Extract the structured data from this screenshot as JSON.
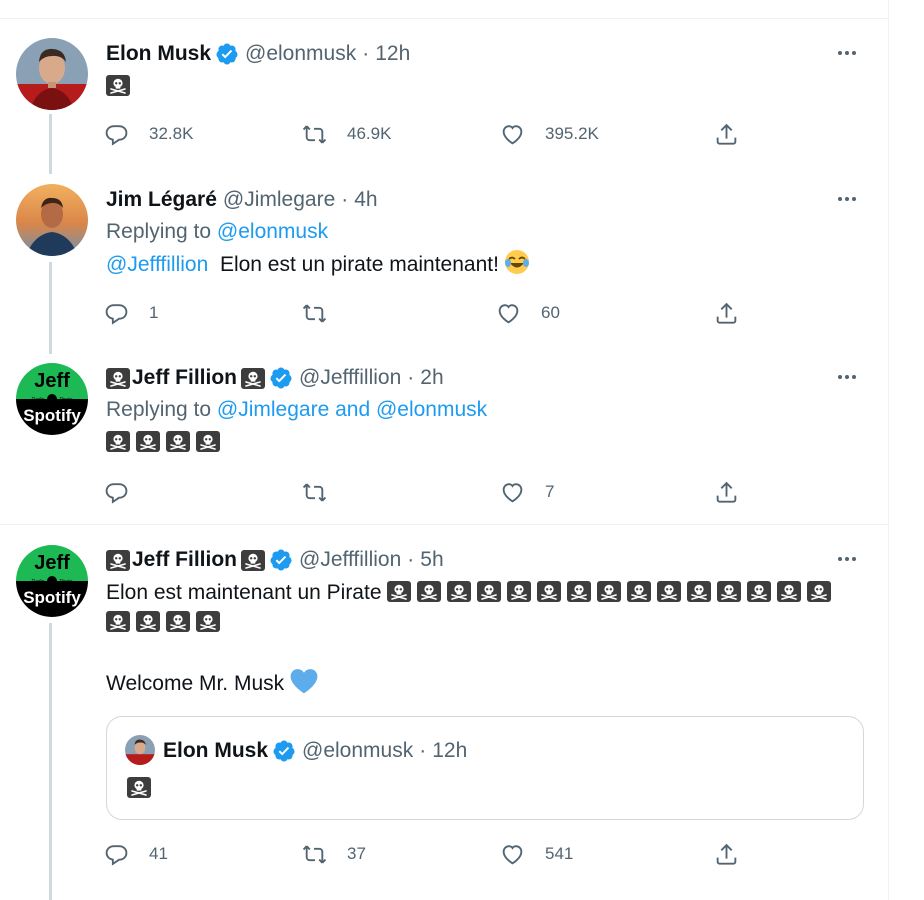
{
  "tweets": [
    {
      "name": "Elon Musk",
      "verified": true,
      "handle": "@elonmusk",
      "sep": "·",
      "time": "12h",
      "text": "",
      "pirate_count": 1,
      "replies": "32.8K",
      "retweets": "46.9K",
      "likes": "395.2K"
    },
    {
      "name": "Jim Légaré",
      "verified": false,
      "handle": "@Jimlegare",
      "sep": "·",
      "time": "4h",
      "replying_prefix": "Replying to ",
      "replying_to": "@elonmusk",
      "mention": "@Jefffillion",
      "text": "Elon est un pirate maintenant!",
      "replies": "1",
      "retweets": "",
      "likes": "60"
    },
    {
      "name": "Jeff Fillion",
      "verified": true,
      "handle": "@Jefffillion",
      "sep": "·",
      "time": "2h",
      "replying_prefix": "Replying to ",
      "replying_to": "@Jimlegare and @elonmusk",
      "pirate_count": 4,
      "replies": "",
      "retweets": "",
      "likes": "7"
    },
    {
      "name": "Jeff Fillion",
      "verified": true,
      "handle": "@Jefffillion",
      "sep": "·",
      "time": "5h",
      "text": "Elon est maintenant un Pirate",
      "pirate_count_line1": 15,
      "pirate_count_line2": 4,
      "text2": "Welcome Mr. Musk",
      "quote": {
        "name": "Elon Musk",
        "handle": "@elonmusk",
        "sep": "·",
        "time": "12h"
      },
      "replies": "41",
      "retweets": "37",
      "likes": "541"
    }
  ],
  "avatars": {
    "jeff_top": "Jeff",
    "jeff_small_left": "Radio",
    "jeff_small_right": "Pirate",
    "jeff_bottom": "Spotify"
  },
  "colors": {
    "accent": "#1d9bf0",
    "muted": "#536471",
    "border": "#cfd9de"
  },
  "icons": [
    "reply-icon",
    "retweet-icon",
    "like-icon",
    "share-icon",
    "more-icon",
    "verified-icon",
    "pirate-flag-icon"
  ]
}
